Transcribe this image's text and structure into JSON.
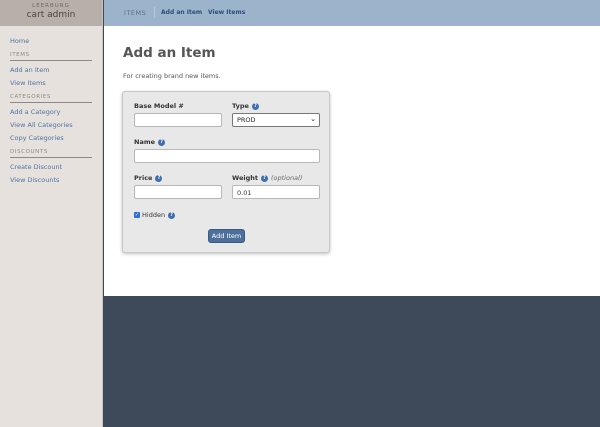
{
  "brand": {
    "sub": "LEERBURG",
    "main": "cart admin"
  },
  "sidebar": {
    "home": "Home",
    "items_section": "ITEMS",
    "items": [
      "Add an Item",
      "View Items"
    ],
    "categories_section": "CATEGORIES",
    "categories": [
      "Add a Category",
      "View All Categories",
      "Copy Categories"
    ],
    "discounts_section": "DISCOUNTS",
    "discounts": [
      "Create Discount",
      "View Discounts"
    ]
  },
  "topbar": {
    "crumb": "ITEMS",
    "links": [
      "Add an Item",
      "View Items"
    ]
  },
  "page": {
    "title": "Add an Item",
    "subtitle": "For creating brand new items."
  },
  "form": {
    "base_model_label": "Base Model #",
    "base_model_value": "",
    "type_label": "Type",
    "type_value": "PROD",
    "name_label": "Name",
    "name_value": "",
    "price_label": "Price",
    "price_value": "",
    "weight_label": "Weight",
    "weight_optional": "(optional)",
    "weight_value": "0.01",
    "hidden_label": "Hidden",
    "hidden_checked": true,
    "submit_label": "Add Item"
  },
  "icons": {
    "help": "question-circle-icon",
    "check": "checkmark-icon",
    "dropdown": "chevron-down-icon"
  },
  "colors": {
    "sidebar": "#e6e1dd",
    "topbar": "#9cb3cc",
    "footer": "#3e4a5a",
    "link": "#4e74a3",
    "button": "#4d6f9b"
  }
}
